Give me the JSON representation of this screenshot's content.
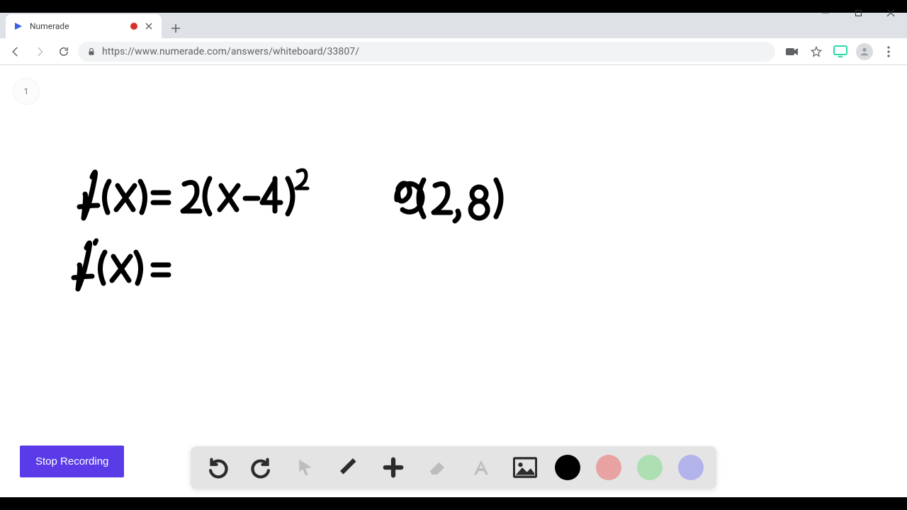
{
  "browser": {
    "tab_title": "Numerade",
    "url": "https://www.numerade.com/answers/whiteboard/33807/"
  },
  "page": {
    "counter": "1",
    "stop_recording_label": "Stop Recording"
  },
  "whiteboard": {
    "line1": "f(x) = 2(x−4)²",
    "annotation": "@ (2, 8)",
    "line2": "f'(x) ="
  },
  "tools": {
    "colors": {
      "black": "#000000",
      "pink": "#e9a2a2",
      "green": "#aedfb2",
      "purple": "#b2b3ea"
    }
  }
}
